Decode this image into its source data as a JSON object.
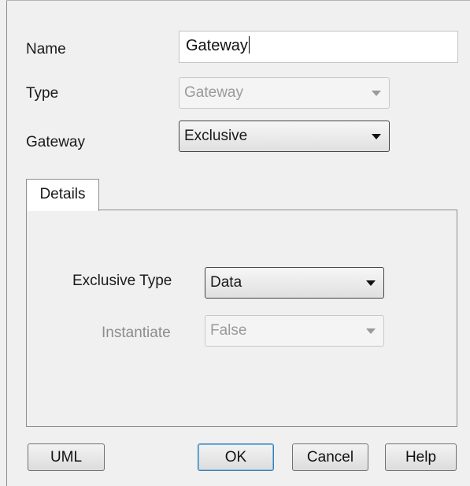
{
  "form": {
    "name_label": "Name",
    "name_value": "Gateway",
    "type_label": "Type",
    "type_value": "Gateway",
    "gateway_label": "Gateway",
    "gateway_value": "Exclusive"
  },
  "details": {
    "tab_label": "Details",
    "exclusive_type_label": "Exclusive Type",
    "exclusive_type_value": "Data",
    "instantiate_label": "Instantiate",
    "instantiate_value": "False"
  },
  "buttons": {
    "uml": "UML",
    "ok": "OK",
    "cancel": "Cancel",
    "help": "Help"
  },
  "icons": {
    "dropdown": "chevron-down-icon"
  }
}
